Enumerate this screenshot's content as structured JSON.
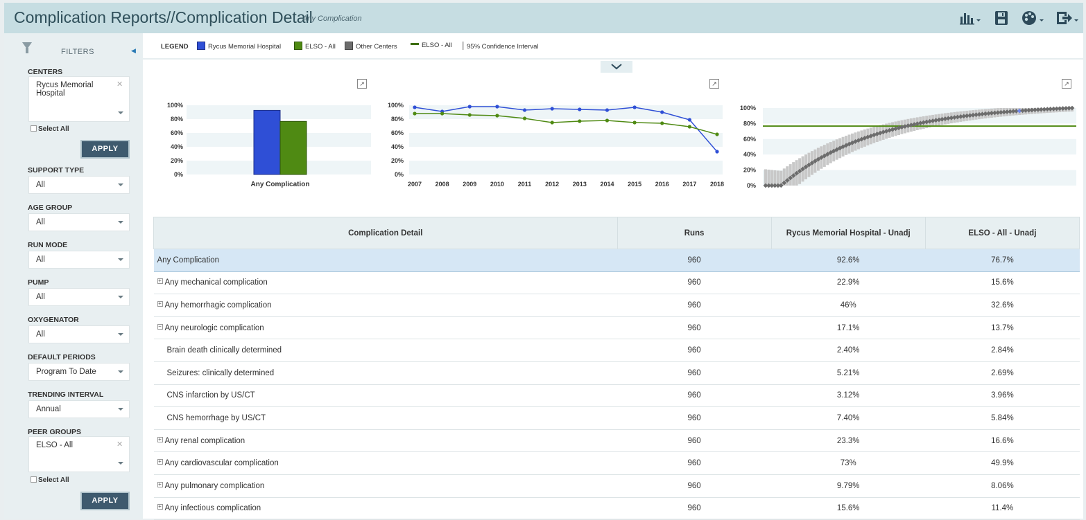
{
  "header": {
    "title": "Complication Reports//Complication Detail",
    "subtitle": "Any Complication",
    "tools": [
      "chart-type-icon",
      "save-icon",
      "palette-icon",
      "export-icon"
    ]
  },
  "sidebar": {
    "filters_label": "FILTERS",
    "centers_label": "CENTERS",
    "centers_value": "Rycus Memorial Hospital",
    "select_all": "Select All",
    "apply": "APPLY",
    "support_type_label": "SUPPORT TYPE",
    "support_type_value": "All",
    "age_group_label": "AGE GROUP",
    "age_group_value": "All",
    "run_mode_label": "RUN MODE",
    "run_mode_value": "All",
    "pump_label": "PUMP",
    "pump_value": "All",
    "oxygenator_label": "OXYGENATOR",
    "oxygenator_value": "All",
    "default_periods_label": "DEFAULT PERIODS",
    "default_periods_value": "Program To Date",
    "trending_interval_label": "TRENDING INTERVAL",
    "trending_interval_value": "Annual",
    "peer_groups_label": "PEER GROUPS",
    "peer_groups_value": "ELSO - All",
    "select_all_2": "Select All",
    "apply_2": "APPLY"
  },
  "legend": {
    "title": "LEGEND",
    "items": [
      "Rycus Memorial Hospital",
      "ELSO - All",
      "Other Centers",
      "ELSO - All",
      "95% Confidence Interval"
    ]
  },
  "colors": {
    "hospital": "#2f4fd6",
    "elso": "#4f8a13",
    "other": "#6c6c6c",
    "ci": "#c8c8c8",
    "accent": "#2f4f5a"
  },
  "chart_data": [
    {
      "type": "bar",
      "categories": [
        "Any Complication"
      ],
      "series": [
        {
          "name": "Rycus Memorial Hospital",
          "values": [
            92.6
          ]
        },
        {
          "name": "ELSO - All",
          "values": [
            76.7
          ]
        }
      ],
      "y_ticks": [
        "100%",
        "80%",
        "60%",
        "40%",
        "20%",
        "0%"
      ],
      "ylim": [
        0,
        100
      ]
    },
    {
      "type": "line",
      "x": [
        "2007",
        "2008",
        "2009",
        "2010",
        "2011",
        "2012",
        "2013",
        "2014",
        "2015",
        "2016",
        "2017",
        "2018"
      ],
      "series": [
        {
          "name": "Rycus Memorial Hospital",
          "values": [
            97,
            91,
            98,
            98,
            93,
            95,
            94,
            93,
            97,
            90,
            79,
            33
          ]
        },
        {
          "name": "ELSO - All",
          "values": [
            88,
            88,
            86,
            85,
            81,
            75,
            77,
            78,
            75,
            74,
            69,
            58
          ]
        }
      ],
      "y_ticks": [
        "100%",
        "80%",
        "60%",
        "40%",
        "20%",
        "0%"
      ],
      "ylim": [
        0,
        100
      ]
    },
    {
      "type": "scatter",
      "y_ticks": [
        "100%",
        "80%",
        "60%",
        "40%",
        "20%",
        "0%"
      ],
      "ylim": [
        0,
        100
      ],
      "elso_reference": 76.7,
      "center_count": 100,
      "highlight_rank": 82,
      "min_value": 0,
      "max_value": 100
    }
  ],
  "table": {
    "headers": [
      "Complication Detail",
      "Runs",
      "Rycus Memorial Hospital - Unadj",
      "ELSO - All - Unadj"
    ],
    "rows": [
      {
        "name": "Any Complication",
        "runs": "960",
        "hosp": "92.6%",
        "elso": "76.7%"
      },
      {
        "name": "Any mechanical complication",
        "runs": "960",
        "hosp": "22.9%",
        "elso": "15.6%"
      },
      {
        "name": "Any hemorrhagic complication",
        "runs": "960",
        "hosp": "46%",
        "elso": "32.6%"
      },
      {
        "name": "Any neurologic complication",
        "runs": "960",
        "hosp": "17.1%",
        "elso": "13.7%"
      },
      {
        "name": "Brain death clinically determined",
        "runs": "960",
        "hosp": "2.40%",
        "elso": "2.84%"
      },
      {
        "name": "Seizures: clinically determined",
        "runs": "960",
        "hosp": "5.21%",
        "elso": "2.69%"
      },
      {
        "name": "CNS infarction by US/CT",
        "runs": "960",
        "hosp": "3.12%",
        "elso": "3.96%"
      },
      {
        "name": "CNS hemorrhage by US/CT",
        "runs": "960",
        "hosp": "7.40%",
        "elso": "5.84%"
      },
      {
        "name": "Any renal complication",
        "runs": "960",
        "hosp": "23.3%",
        "elso": "16.6%"
      },
      {
        "name": "Any cardiovascular complication",
        "runs": "960",
        "hosp": "73%",
        "elso": "49.9%"
      },
      {
        "name": "Any pulmonary complication",
        "runs": "960",
        "hosp": "9.79%",
        "elso": "8.06%"
      },
      {
        "name": "Any infectious complication",
        "runs": "960",
        "hosp": "15.6%",
        "elso": "11.4%"
      }
    ]
  }
}
